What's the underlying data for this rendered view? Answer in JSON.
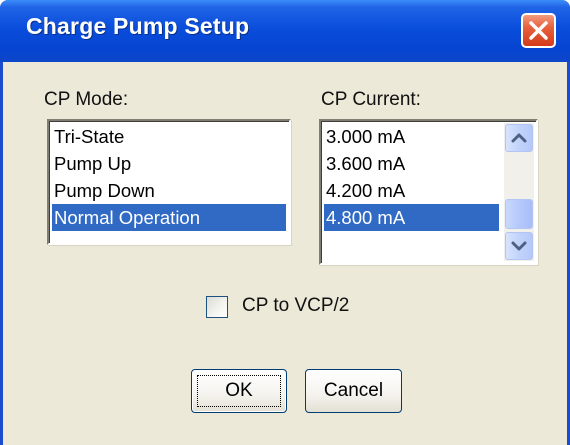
{
  "window": {
    "title": "Charge Pump Setup"
  },
  "cp_mode": {
    "label": "CP Mode:",
    "items": [
      {
        "label": "Tri-State",
        "selected": false
      },
      {
        "label": "Pump Up",
        "selected": false
      },
      {
        "label": "Pump Down",
        "selected": false
      },
      {
        "label": "Normal Operation",
        "selected": true
      }
    ]
  },
  "cp_current": {
    "label": "CP Current:",
    "items": [
      {
        "label": "3.000 mA",
        "selected": false
      },
      {
        "label": "3.600 mA",
        "selected": false
      },
      {
        "label": "4.200 mA",
        "selected": false
      },
      {
        "label": "4.800 mA",
        "selected": true
      }
    ]
  },
  "options": {
    "cp_to_vcp2_label": "CP to VCP/2",
    "cp_to_vcp2_checked": false
  },
  "buttons": {
    "ok_label": "OK",
    "cancel_label": "Cancel"
  },
  "colors": {
    "title_bar": "#0a4edc",
    "selection": "#316ac5",
    "dialog_face": "#ece9d8",
    "close_button": "#e7613d"
  },
  "icons": {
    "close": "close-icon",
    "scroll_up": "chevron-up-icon",
    "scroll_down": "chevron-down-icon"
  }
}
